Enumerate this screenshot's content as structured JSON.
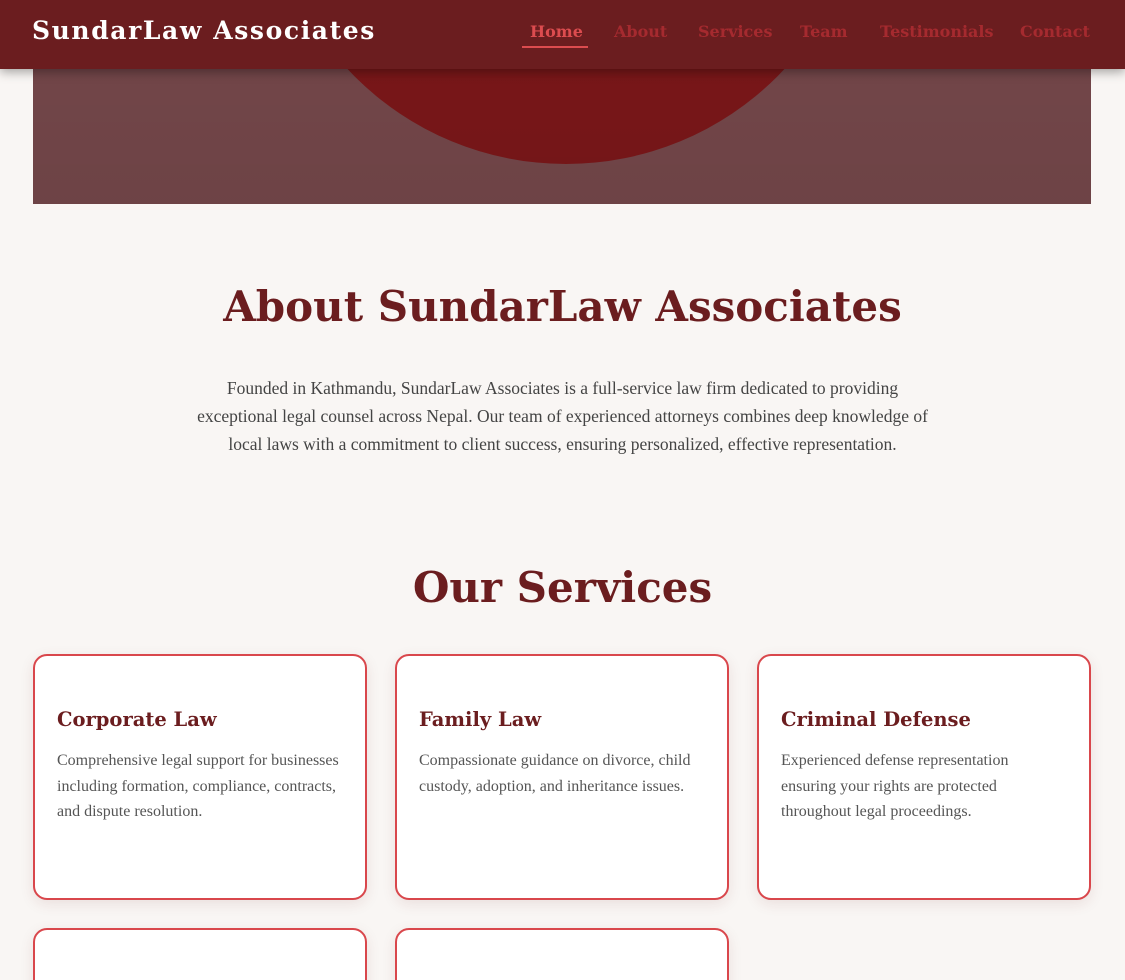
{
  "brand": "SundarLaw Associates",
  "nav": {
    "items": [
      "Home",
      "About",
      "Services",
      "Team",
      "Testimonials",
      "Contact"
    ],
    "active": "Home"
  },
  "colors": {
    "primary": "#6b1d1f",
    "accent": "#dc4c4f",
    "nav_link": "#a52a2f",
    "background": "#f9f6f4",
    "card_border": "#d9474c"
  },
  "about": {
    "title": "About SundarLaw Associates",
    "text": "Founded in Kathmandu, SundarLaw Associates is a full-service law firm dedicated to providing exceptional legal counsel across Nepal. Our team of experienced attorneys combines deep knowledge of local laws with a commitment to client success, ensuring personalized, effective representation."
  },
  "services": {
    "title": "Our Services",
    "items": [
      {
        "title": "Corporate Law",
        "description": "Comprehensive legal support for businesses including formation, compliance, contracts, and dispute resolution."
      },
      {
        "title": "Family Law",
        "description": "Compassionate guidance on divorce, child custody, adoption, and inheritance issues."
      },
      {
        "title": "Criminal Defense",
        "description": "Experienced defense representation ensuring your rights are protected throughout legal proceedings."
      }
    ]
  }
}
